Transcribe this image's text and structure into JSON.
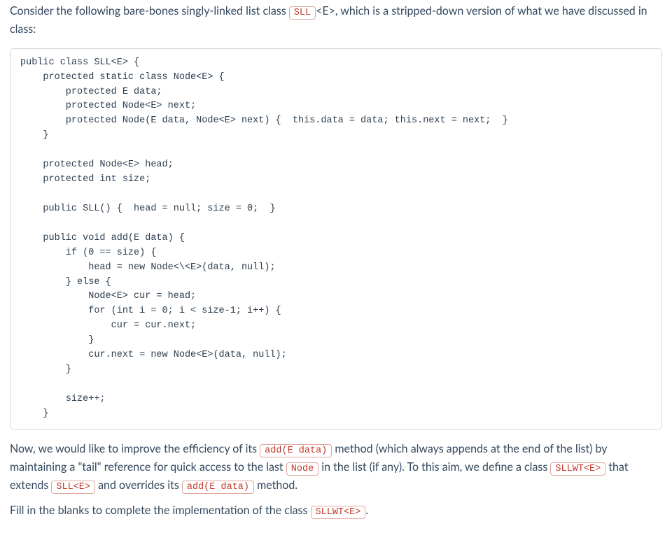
{
  "intro": {
    "part1": "Consider the following bare-bones singly-linked list class ",
    "code1": "SLL",
    "part2": "<E>, which is a stripped-down version of what we have discussed in class:"
  },
  "codeblock": "public class SLL<E> {\n    protected static class Node<E> {\n        protected E data;\n        protected Node<E> next;\n        protected Node(E data, Node<E> next) {  this.data = data; this.next = next;  }\n    }\n\n    protected Node<E> head;\n    protected int size;\n\n    public SLL() {  head = null; size = 0;  }\n\n    public void add(E data) {\n        if (0 == size) {\n            head = new Node<\\<E>(data, null);\n        } else {\n            Node<E> cur = head;\n            for (int i = 0; i < size-1; i++) {\n                cur = cur.next;\n            }\n            cur.next = new Node<E>(data, null);\n        }\n\n        size++;\n    }",
  "para2": {
    "part1": "Now, we would like to improve the efficiency of its ",
    "code1": "add(E data)",
    "part2": " method (which always appends at the end of the list) by maintaining a \"tail\" reference for quick access to the last ",
    "code2": "Node",
    "part3": " in the list (if any).  To this aim, we define a class ",
    "code3": "SLLWT<E>",
    "part4": " that extends ",
    "code4": "SLL<E>",
    "part5": " and overrides its ",
    "code5": "add(E data)",
    "part6": " method."
  },
  "para3": {
    "part1": "Fill in the blanks to complete the implementation of the class ",
    "code1": "SLLWT<E>",
    "part2": "."
  }
}
